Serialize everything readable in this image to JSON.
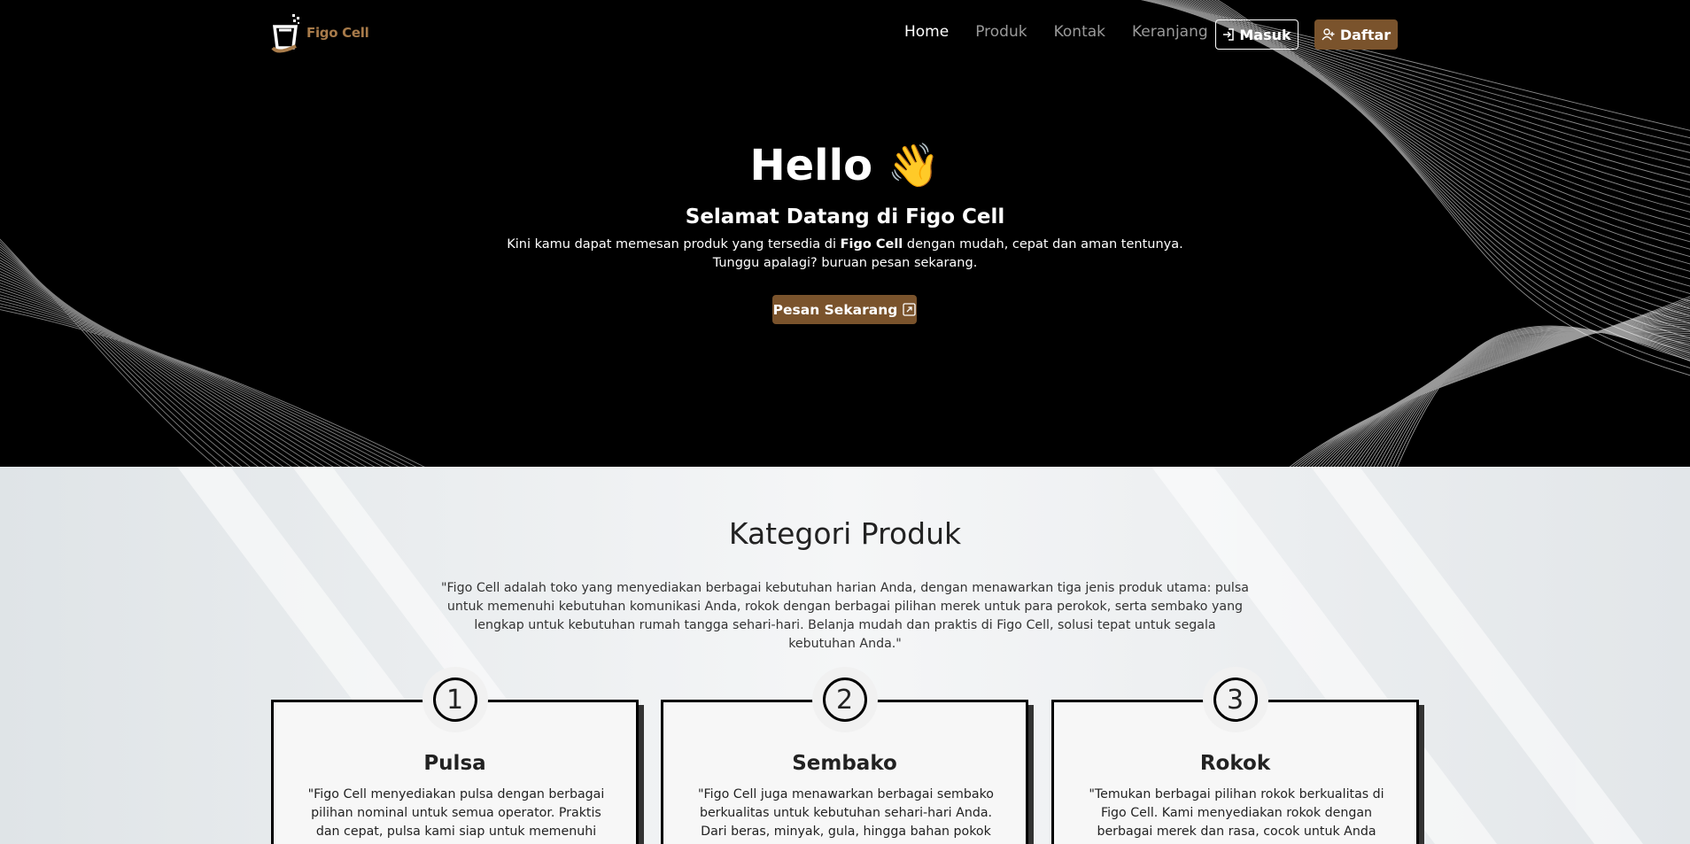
{
  "nav": {
    "logo_text": "Figo Cell",
    "links": [
      "Home",
      "Produk",
      "Kontak",
      "Keranjang"
    ],
    "masuk_label": "Masuk",
    "daftar_label": "Daftar"
  },
  "hero": {
    "title": "Hello 👋",
    "subtitle": "Selamat Datang di Figo Cell",
    "desc_before": "Kini kamu dapat memesan produk yang tersedia di ",
    "desc_bold": "Figo Cell",
    "desc_after": " dengan mudah, cepat dan aman tentunya.",
    "desc_line2": "Tunggu apalagi? buruan pesan sekarang.",
    "cta_label": "Pesan Sekarang"
  },
  "kategori": {
    "title": "Kategori Produk",
    "desc": "\"Figo Cell adalah toko yang menyediakan berbagai kebutuhan harian Anda, dengan menawarkan tiga jenis produk utama: pulsa untuk memenuhi kebutuhan komunikasi Anda, rokok dengan berbagai pilihan merek untuk para perokok, serta sembako yang lengkap untuk kebutuhan rumah tangga sehari-hari. Belanja mudah dan praktis di Figo Cell, solusi tepat untuk segala kebutuhan Anda.\"",
    "cards": [
      {
        "num": "1",
        "title": "Pulsa",
        "text": "\"Figo Cell menyediakan pulsa dengan berbagai pilihan nominal untuk semua operator. Praktis dan cepat, pulsa kami siap untuk memenuhi kebutuhan"
      },
      {
        "num": "2",
        "title": "Sembako",
        "text": "\"Figo Cell juga menawarkan berbagai sembako berkualitas untuk kebutuhan sehari-hari Anda. Dari beras, minyak, gula, hingga bahan pokok lainnya,"
      },
      {
        "num": "3",
        "title": "Rokok",
        "text": "\"Temukan berbagai pilihan rokok berkualitas di Figo Cell. Kami menyediakan rokok dengan berbagai merek dan rasa, cocok untuk Anda yang menikmati"
      }
    ]
  }
}
